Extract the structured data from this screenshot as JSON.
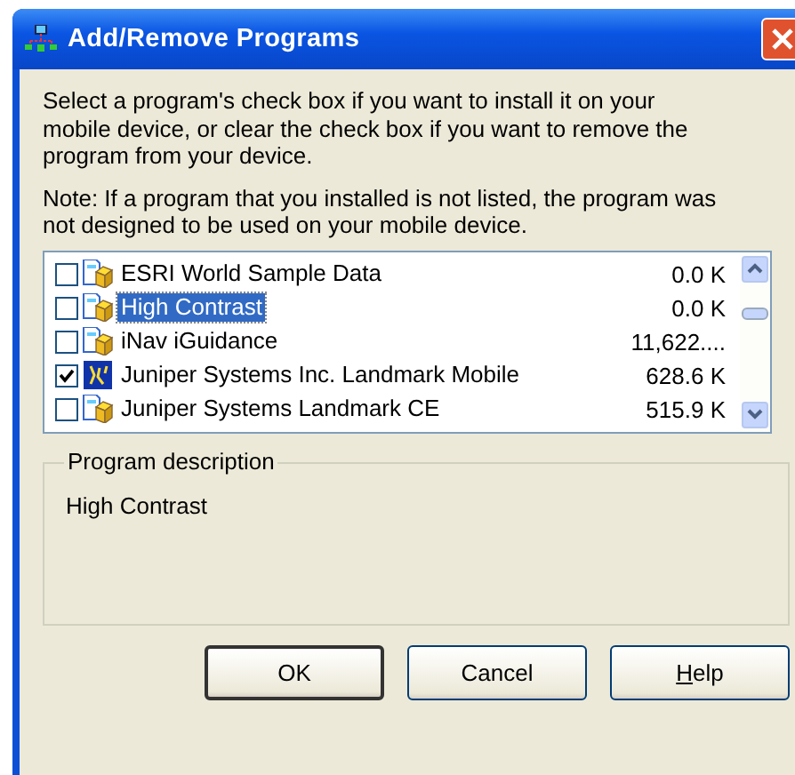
{
  "window": {
    "title": "Add/Remove Programs"
  },
  "instructions": "Select a program's check box if you want to install it on your mobile device, or clear the check box if you want to remove the program from your device.",
  "note": "Note:  If a program that you installed is not listed, the program was not designed to be used on your mobile device.",
  "programs": [
    {
      "name": "ESRI World Sample Data",
      "size": "0.0 K",
      "checked": false,
      "selected": false,
      "kind": "package"
    },
    {
      "name": "High Contrast",
      "size": "0.0 K",
      "checked": false,
      "selected": true,
      "kind": "package"
    },
    {
      "name": "iNav iGuidance",
      "size": "11,622....",
      "checked": false,
      "selected": false,
      "kind": "package"
    },
    {
      "name": "Juniper Systems Inc. Landmark Mobile",
      "size": "628.6 K",
      "checked": true,
      "selected": false,
      "kind": "app"
    },
    {
      "name": "Juniper Systems Landmark CE",
      "size": "515.9 K",
      "checked": false,
      "selected": false,
      "kind": "package"
    }
  ],
  "description": {
    "label": "Program description",
    "text": "High Contrast"
  },
  "buttons": [
    {
      "label": "OK",
      "default": true
    },
    {
      "label": "Cancel",
      "default": false
    },
    {
      "label": "Help",
      "default": false
    }
  ]
}
